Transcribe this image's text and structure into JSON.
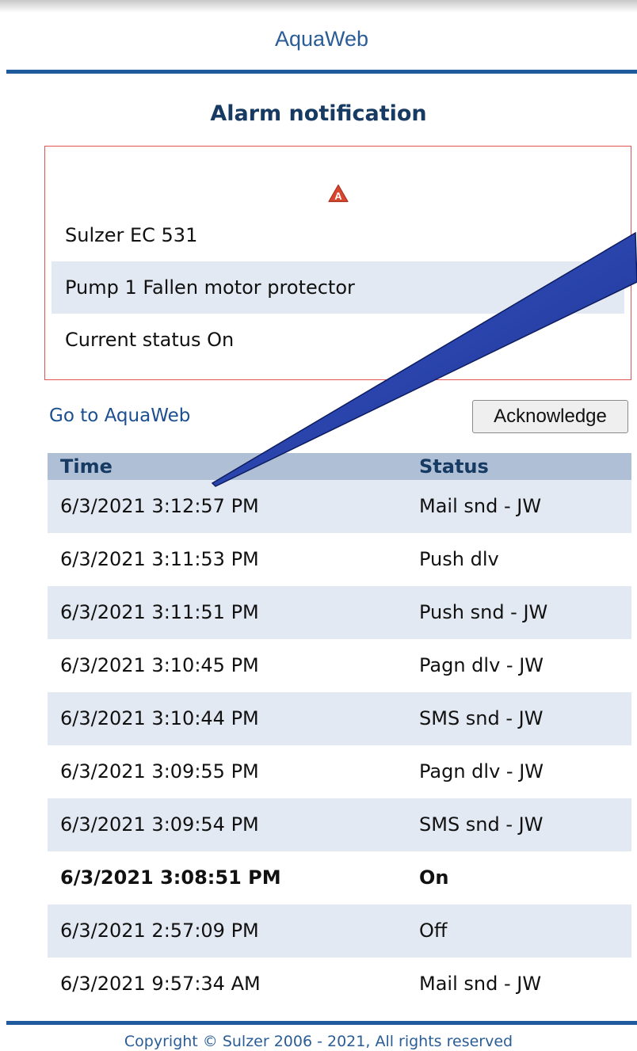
{
  "header": {
    "brand": "AquaWeb"
  },
  "page_title": "Alarm notification",
  "alarm": {
    "icon": "alarm-a-icon",
    "icon_letter": "A",
    "device": "Sulzer EC 531",
    "message": "Pump 1 Fallen motor protector",
    "current_status": "Current status On"
  },
  "actions": {
    "goto_label": "Go to AquaWeb",
    "acknowledge_label": "Acknowledge"
  },
  "history": {
    "columns": [
      "Time",
      "Status"
    ],
    "rows": [
      {
        "time": "6/3/2021 3:12:57 PM",
        "status": "Mail snd - JW"
      },
      {
        "time": "6/3/2021 3:11:53 PM",
        "status": "Push dlv"
      },
      {
        "time": "6/3/2021 3:11:51 PM",
        "status": "Push snd - JW"
      },
      {
        "time": "6/3/2021 3:10:45 PM",
        "status": "Pagn dlv - JW"
      },
      {
        "time": "6/3/2021 3:10:44 PM",
        "status": "SMS snd - JW"
      },
      {
        "time": "6/3/2021 3:09:55 PM",
        "status": "Pagn dlv - JW"
      },
      {
        "time": "6/3/2021 3:09:54 PM",
        "status": "SMS snd - JW"
      },
      {
        "time": "6/3/2021 3:08:51 PM",
        "status": "On"
      },
      {
        "time": "6/3/2021 2:57:09 PM",
        "status": "Off"
      },
      {
        "time": "6/3/2021 9:57:34 AM",
        "status": "Mail snd - JW"
      }
    ]
  },
  "footer": {
    "copyright": "Copyright © Sulzer 2006 - 2021, All rights reserved"
  },
  "colors": {
    "brand_blue": "#1e5a9c",
    "alarm_red": "#d9462f",
    "alarm_border": "#e25454",
    "row_shade": "#e3e9f2",
    "header_shade": "#aebfd6",
    "callout_arrow": "#1f3fa8"
  }
}
